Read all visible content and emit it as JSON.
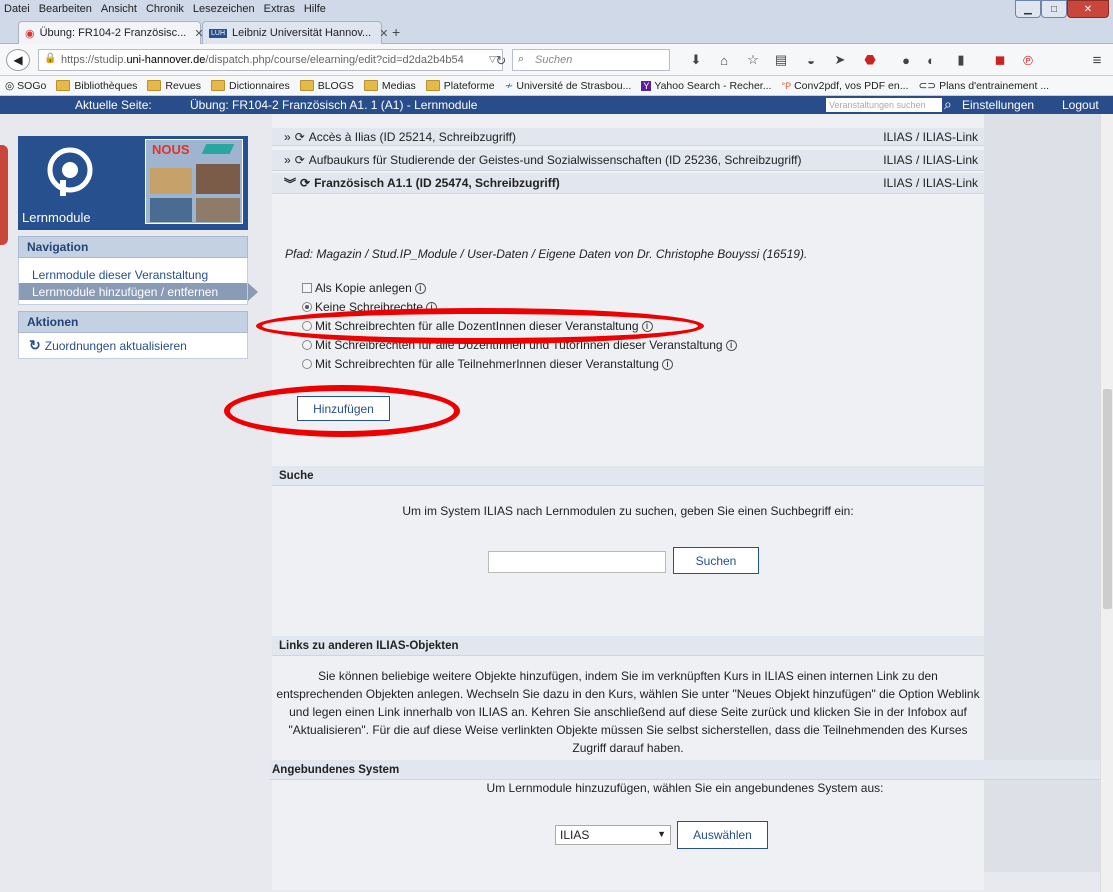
{
  "menubar": {
    "items": [
      "Datei",
      "Bearbeiten",
      "Ansicht",
      "Chronik",
      "Lesezeichen",
      "Extras",
      "Hilfe"
    ]
  },
  "tabs": [
    {
      "label": "Übung: FR104-2 Französisc..."
    },
    {
      "label": "Leibniz Universität Hannov..."
    }
  ],
  "new_tab": "+",
  "address": {
    "prefix": "https://studip.",
    "host": "uni-hannover.de",
    "path": "/dispatch.php/course/elearning/edit?cid=d2da2b4b54"
  },
  "search_placeholder": "Suchen",
  "bookmarks": [
    "SOGo",
    "Bibliothèques",
    "Revues",
    "Dictionnaires",
    "BLOGS",
    "Medias",
    "Plateforme",
    "Université de Strasbou...",
    "Yahoo Search - Recher...",
    "Conv2pdf, vos PDF en...",
    "Plans d'entrainement ..."
  ],
  "header": {
    "current_label": "Aktuelle Seite:",
    "current_value": "Übung: FR104-2 Französisch A1. 1 (A1) - Lernmodule",
    "search_placeholder": "Veranstaltungen suchen",
    "settings": "Einstellungen",
    "logout": "Logout"
  },
  "sidebar": {
    "module_title": "Lernmodule",
    "logo_text": "NOUS",
    "nav_head": "Navigation",
    "nav_items": [
      {
        "label": "Lernmodule dieser Veranstaltung"
      },
      {
        "label": "Lernmodule hinzufügen / entfernen"
      }
    ],
    "actions_head": "Aktionen",
    "action_items": [
      {
        "label": "Zuordnungen aktualisieren"
      }
    ]
  },
  "modules": [
    {
      "name": "Accès à Ilias (ID 25214, Schreibzugriff)",
      "link": "ILIAS / ILIAS-Link"
    },
    {
      "name": "Aufbaukurs für Studierende der Geistes-und Sozialwissenschaften (ID 25236, Schreibzugriff)",
      "link": "ILIAS / ILIAS-Link"
    },
    {
      "name": "Französisch A1.1 (ID 25474, Schreibzugriff)",
      "link": "ILIAS / ILIAS-Link"
    }
  ],
  "path_text": "Pfad: Magazin / Stud.IP_Module / User-Daten / Eigene Daten von Dr. Christophe Bouyssi (16519).",
  "options": {
    "copy": "Als Kopie anlegen",
    "radios": [
      {
        "label": "Keine Schreibrechte",
        "selected": true
      },
      {
        "label": "Mit Schreibrechten für alle DozentInnen dieser Veranstaltung",
        "selected": false
      },
      {
        "label": "Mit Schreibrechten für alle DozentInnen und TutorInnen dieser Veranstaltung",
        "selected": false
      },
      {
        "label": "Mit Schreibrechten für alle TeilnehmerInnen dieser Veranstaltung",
        "selected": false
      }
    ]
  },
  "add_button": "Hinzufügen",
  "search_section": {
    "title": "Suche",
    "hint": "Um im System ILIAS nach Lernmodulen zu suchen, geben Sie einen Suchbegriff ein:",
    "button": "Suchen"
  },
  "links_section": {
    "title": "Links zu anderen ILIAS-Objekten",
    "text": "Sie können beliebige weitere Objekte hinzufügen, indem Sie im verknüpften Kurs in ILIAS einen internen Link zu den entsprechenden Objekten anlegen. Wechseln Sie dazu in den Kurs, wählen Sie unter \"Neues Objekt hinzufügen\" die Option Weblink und legen einen Link innerhalb von ILIAS an. Kehren Sie anschließend auf diese Seite zurück und klicken Sie in der Infobox auf \"Aktualisieren\". Für die auf diese Weise verlinkten Objekte müssen Sie selbst sicherstellen, dass die Teilnehmenden des Kurses Zugriff darauf haben."
  },
  "system_section": {
    "title": "Angebundenes System",
    "hint": "Um Lernmodule hinzuzufügen, wählen Sie ein angebundenes System aus:",
    "selected": "ILIAS",
    "button": "Auswählen"
  },
  "colors": {
    "brand": "#284d8a",
    "highlight": "#e00000"
  }
}
